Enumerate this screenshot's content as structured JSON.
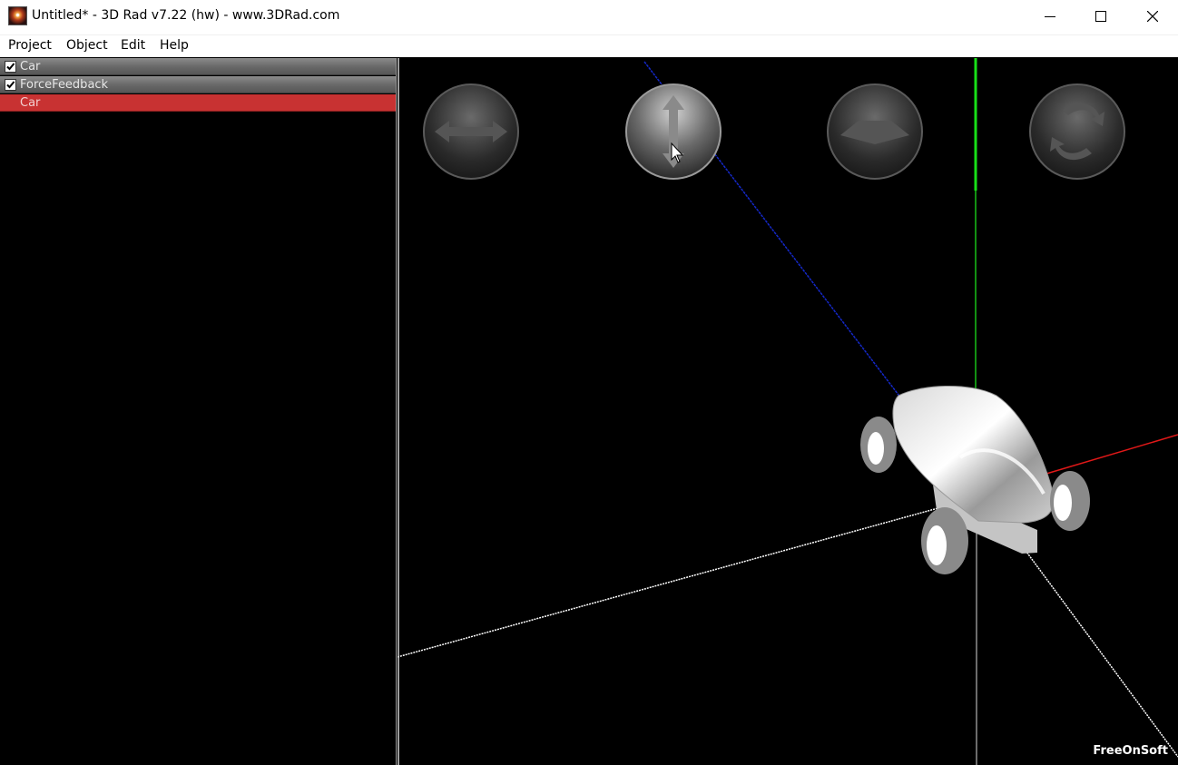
{
  "window": {
    "title": "Untitled* - 3D Rad v7.22 (hw) - www.3DRad.com",
    "app_icon": "3drad-app-icon",
    "controls": [
      "minimize-icon",
      "maximize-icon",
      "close-icon"
    ]
  },
  "menu": {
    "items": [
      {
        "label": "Project"
      },
      {
        "label": "Object"
      },
      {
        "label": "Edit"
      },
      {
        "label": "Help"
      }
    ]
  },
  "object_list": {
    "items": [
      {
        "label": "Car",
        "checked": true,
        "selected": false
      },
      {
        "label": "ForceFeedback",
        "checked": true,
        "selected": false
      },
      {
        "label": "Car",
        "checked": false,
        "selected": true
      }
    ],
    "selected_color": "#c83232"
  },
  "viewport": {
    "tools": [
      {
        "name": "move-horizontal-tool",
        "icon": "double-arrow-horizontal-icon",
        "active": false
      },
      {
        "name": "move-vertical-tool",
        "icon": "double-arrow-vertical-icon",
        "active": true
      },
      {
        "name": "move-plane-tool",
        "icon": "plane-icon",
        "active": false
      },
      {
        "name": "rotate-tool",
        "icon": "rotate-arrows-icon",
        "active": false
      }
    ],
    "axis_colors": {
      "x": "#d01818",
      "y": "#18d018",
      "z": "#1020c0"
    },
    "watermark": "FreeOnSoft"
  }
}
